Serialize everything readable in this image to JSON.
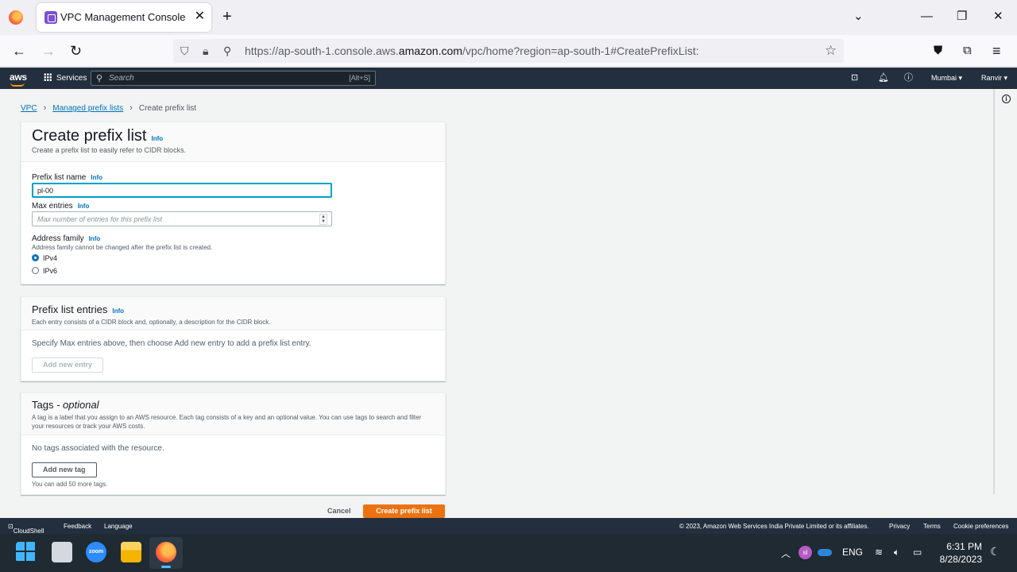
{
  "browser": {
    "tab_title": "VPC Management Console",
    "url_prefix": "https://ap-south-1.console.aws.",
    "url_domain": "amazon.com",
    "url_suffix": "/vpc/home?region=ap-south-1#CreatePrefixList:"
  },
  "aws_nav": {
    "services_label": "Services",
    "search_placeholder": "Search",
    "search_shortcut": "[Alt+S]",
    "region": "Mumbai ▾",
    "account": "Ranvir ▾"
  },
  "breadcrumb": [
    "VPC",
    "Managed prefix lists",
    "Create prefix list"
  ],
  "main_panel": {
    "title": "Create prefix list",
    "info": "Info",
    "description": "Create a prefix list to easily refer to CIDR blocks.",
    "name_label": "Prefix list name",
    "name_value": "pl-00",
    "max_label": "Max entries",
    "max_placeholder": "Max number of entries for this prefix list",
    "family_label": "Address family",
    "family_desc": "Address family cannot be changed after the prefix list is created.",
    "family_options": [
      "IPv4",
      "IPv6"
    ],
    "family_selected": "IPv4"
  },
  "entries_panel": {
    "title": "Prefix list entries",
    "info": "Info",
    "description": "Each entry consists of a CIDR block and, optionally, a description for the CIDR block.",
    "empty_text": "Specify Max entries above, then choose Add new entry to add a prefix list entry.",
    "add_button": "Add new entry"
  },
  "tags_panel": {
    "title": "Tags",
    "title_suffix": " - optional",
    "description": "A tag is a label that you assign to an AWS resource. Each tag consists of a key and an optional value. You can use tags to search and filter your resources or track your AWS costs.",
    "empty_text": "No tags associated with the resource.",
    "add_button": "Add new tag",
    "remaining": "You can add 50 more tags."
  },
  "actions": {
    "cancel": "Cancel",
    "submit": "Create prefix list"
  },
  "footer": {
    "cloudshell": "CloudShell",
    "feedback": "Feedback",
    "language": "Language",
    "copyright": "© 2023, Amazon Web Services India Private Limited or its affiliates.",
    "privacy": "Privacy",
    "terms": "Terms",
    "cookies": "Cookie preferences"
  },
  "taskbar": {
    "zoom_label": "zoom",
    "avatar_initials": "sl",
    "language": "ENG",
    "time": "6:31 PM",
    "date": "8/28/2023"
  },
  "colors": {
    "aws_nav": "#232f3e",
    "primary_button": "#ec7211",
    "link": "#0073bb",
    "focus": "#00a1c9"
  }
}
